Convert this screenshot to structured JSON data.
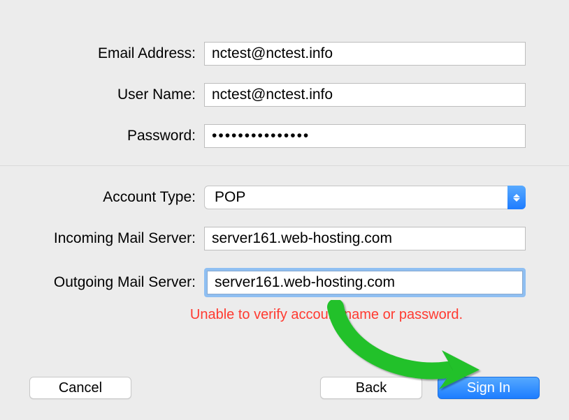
{
  "fields": {
    "email_label": "Email Address:",
    "email_value": "nctest@nctest.info",
    "username_label": "User Name:",
    "username_value": "nctest@nctest.info",
    "password_label": "Password:",
    "password_value": "•••••••••••••••",
    "account_type_label": "Account Type:",
    "account_type_value": "POP",
    "incoming_label": "Incoming Mail Server:",
    "incoming_value": "server161.web-hosting.com",
    "outgoing_label": "Outgoing Mail Server:",
    "outgoing_value": "server161.web-hosting.com"
  },
  "error_message": "Unable to verify account name or password.",
  "buttons": {
    "cancel": "Cancel",
    "back": "Back",
    "sign_in": "Sign In"
  }
}
